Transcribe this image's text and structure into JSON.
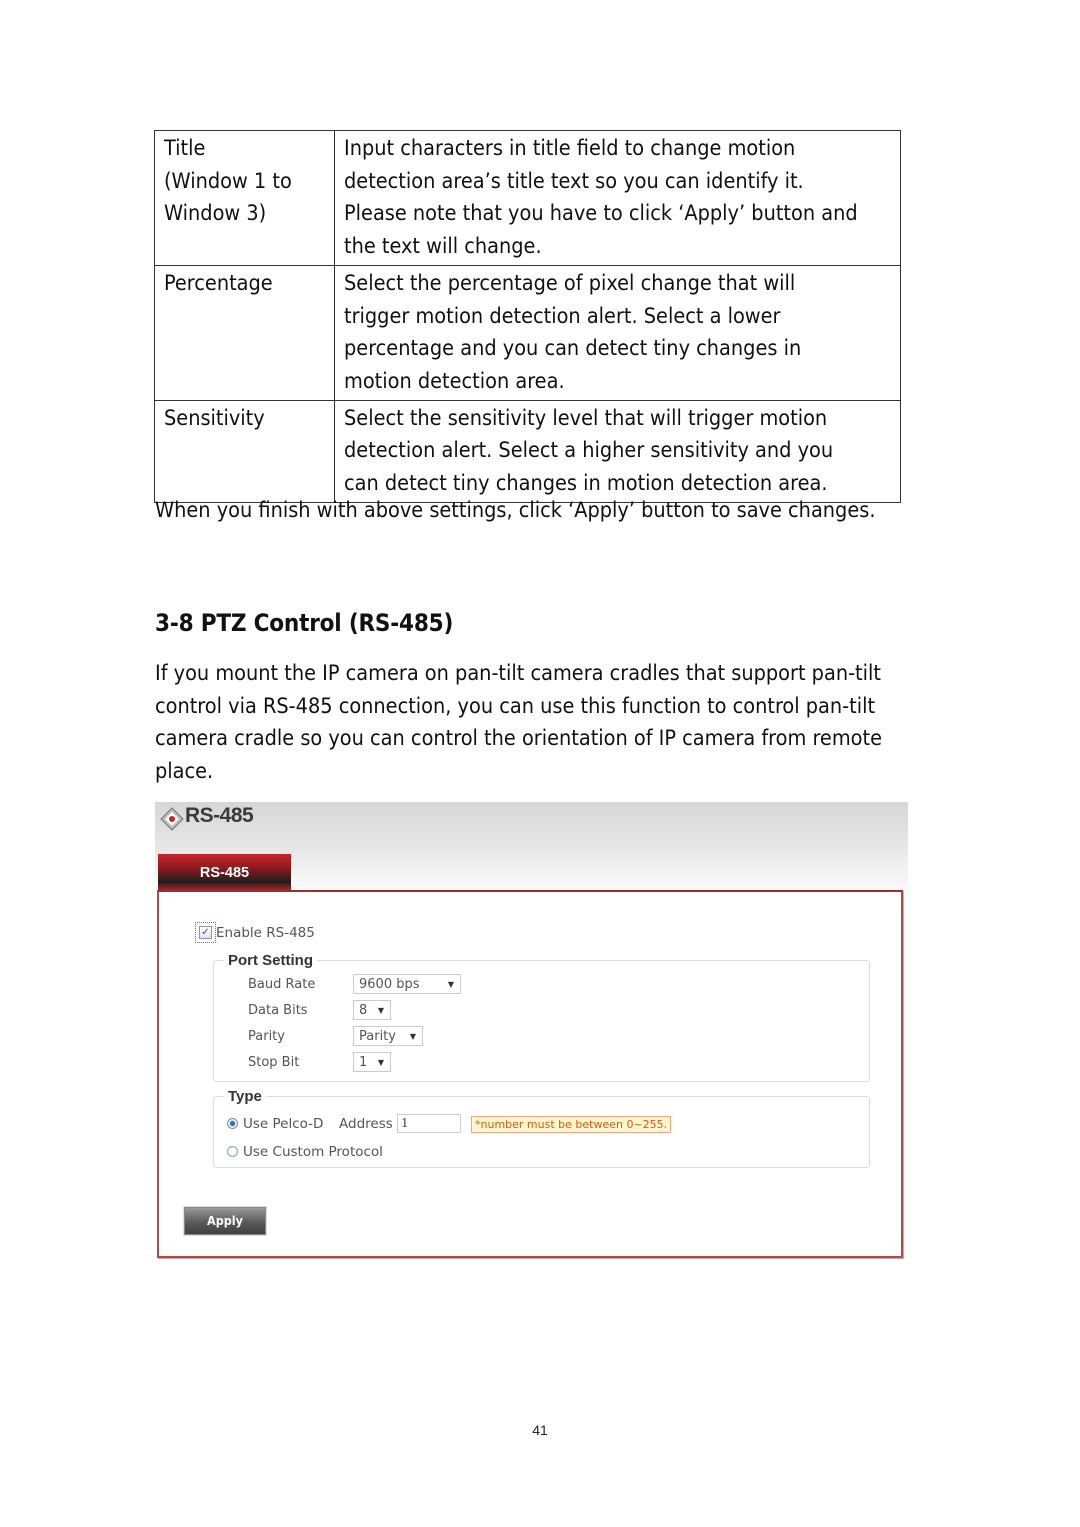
{
  "param_table": {
    "rows": [
      {
        "key_lines": [
          "Title",
          "(Window 1 to",
          "Window 3)"
        ],
        "value_lines": [
          "Input characters in title field to change motion",
          "detection area’s title text so you can identify it.",
          "Please note that you have to click ‘Apply’ button and",
          "the text will change."
        ]
      },
      {
        "key_lines": [
          "Percentage"
        ],
        "value_lines": [
          "Select the percentage of pixel change that will",
          "trigger motion detection alert. Select a lower",
          "percentage and you can detect tiny changes in",
          "motion detection area."
        ]
      },
      {
        "key_lines": [
          "Sensitivity"
        ],
        "value_lines": [
          "Select the sensitivity level that will trigger motion",
          "detection alert. Select a higher sensitivity and you",
          "can detect tiny changes in motion detection area."
        ]
      }
    ]
  },
  "after_table_text": "When you finish with above settings, click ‘Apply’ button to save changes.",
  "section": {
    "heading": "3-8 PTZ Control (RS-485)",
    "intro_lines": [
      "If you mount the IP camera on pan-tilt camera cradles that support pan-tilt",
      "control via RS-485 connection, you can use this function to control pan-tilt",
      "camera cradle so you can control the orientation of IP camera from remote",
      "place."
    ]
  },
  "ui": {
    "header_title": "RS-485",
    "logo_icon": "diamond-logo-icon",
    "tab_label": "RS-485",
    "enable_checkbox": {
      "label": "Enable RS-485",
      "checked": true,
      "glyph": "✓"
    },
    "port_setting": {
      "legend": "Port Setting",
      "fields": [
        {
          "label": "Baud Rate",
          "value": "9600 bps"
        },
        {
          "label": "Data Bits",
          "value": "8"
        },
        {
          "label": "Parity",
          "value": "Parity"
        },
        {
          "label": "Stop Bit",
          "value": "1"
        }
      ],
      "caret_glyph": "▼"
    },
    "type": {
      "legend": "Type",
      "option_pelco": "Use Pelco-D",
      "address_label": "Address",
      "address_value": "1",
      "hint": "*number must be between 0~255.",
      "option_custom": "Use Custom Protocol",
      "selected": "Use Pelco-D"
    },
    "apply_label": "Apply",
    "colors": {
      "accent_red": "#b21e22",
      "panel_border": "#b34a4a",
      "hint_text": "#d4581f",
      "hint_bg": "#fff6cc"
    }
  },
  "page_number": "41"
}
